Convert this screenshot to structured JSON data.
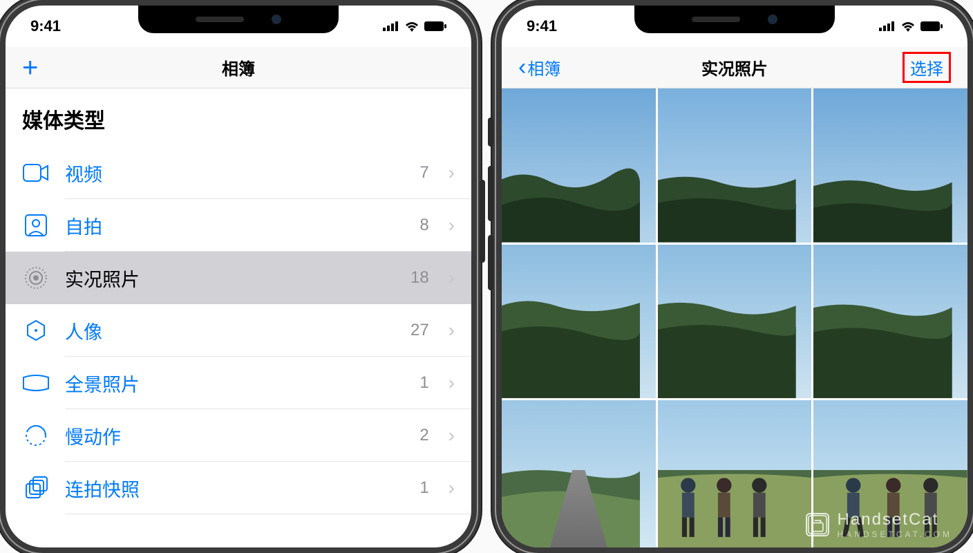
{
  "status": {
    "time": "9:41"
  },
  "left_phone": {
    "nav_title": "相簿",
    "section_header": "媒体类型",
    "items": [
      {
        "icon": "video-icon",
        "label": "视频",
        "count": "7",
        "selected": false
      },
      {
        "icon": "selfie-icon",
        "label": "自拍",
        "count": "8",
        "selected": false
      },
      {
        "icon": "live-photo-icon",
        "label": "实况照片",
        "count": "18",
        "selected": true
      },
      {
        "icon": "portrait-icon",
        "label": "人像",
        "count": "27",
        "selected": false
      },
      {
        "icon": "panorama-icon",
        "label": "全景照片",
        "count": "1",
        "selected": false
      },
      {
        "icon": "slo-mo-icon",
        "label": "慢动作",
        "count": "2",
        "selected": false
      },
      {
        "icon": "burst-icon",
        "label": "连拍快照",
        "count": "1",
        "selected": false
      }
    ]
  },
  "right_phone": {
    "back_label": "相簿",
    "nav_title": "实况照片",
    "select_label": "选择"
  },
  "watermark": {
    "line1": "HandsetCat",
    "line2": "HANDSETCAT.COM"
  },
  "colors": {
    "accent": "#007aff",
    "highlight_border": "#ff0000",
    "muted": "#8e8e93"
  }
}
